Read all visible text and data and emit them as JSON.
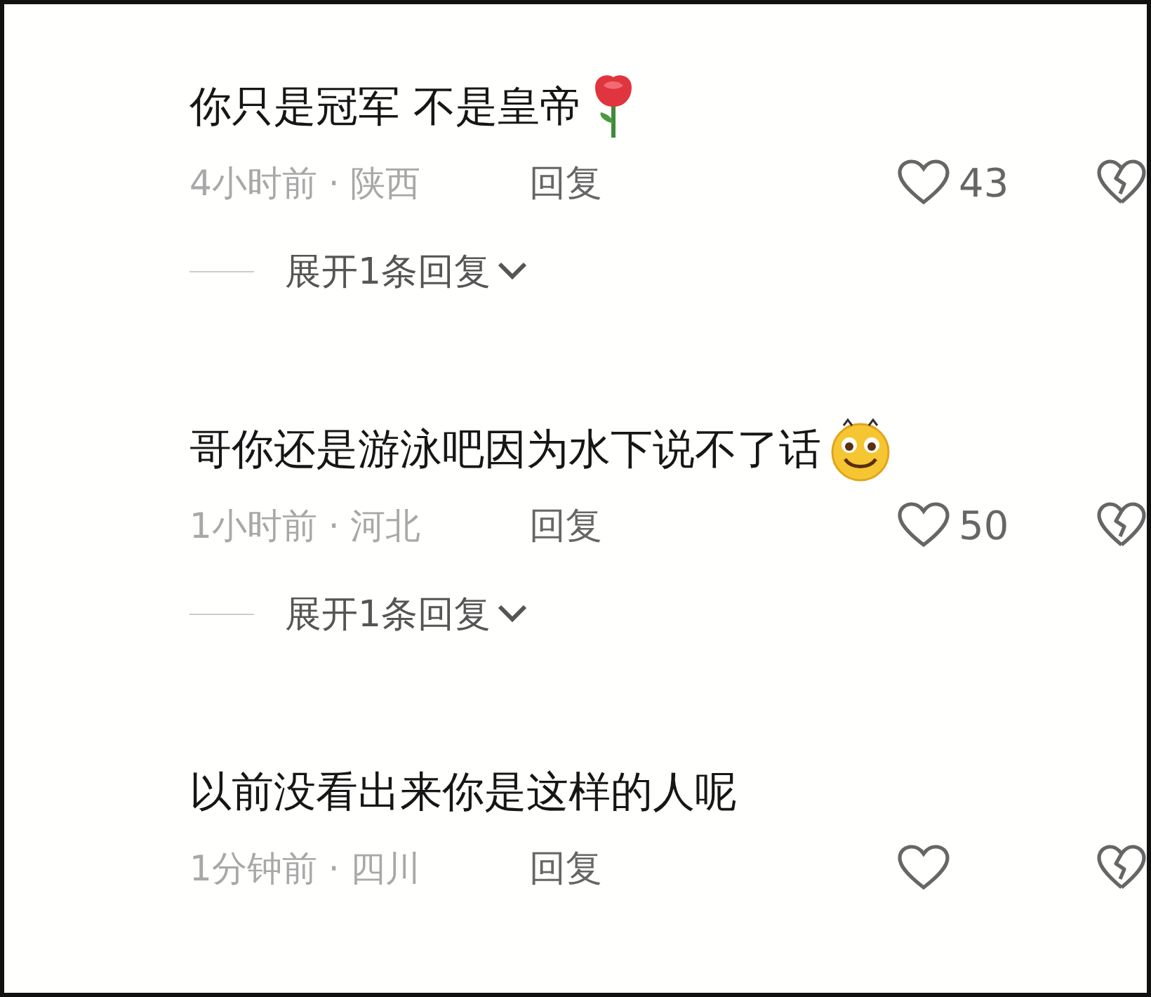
{
  "comments": [
    {
      "kind": "rose",
      "text": "你只是冠军 不是皇帝",
      "meta": "4小时前 · 陕西",
      "reply": "回复",
      "likes": "43",
      "expand": "展开1条回复"
    },
    {
      "kind": "smile",
      "text": "哥你还是游泳吧因为水下说不了话",
      "meta": "1小时前 · 河北",
      "reply": "回复",
      "likes": "50",
      "expand": "展开1条回复"
    },
    {
      "kind": "plain",
      "text": "以前没看出来你是这样的人呢",
      "meta": "1分钟前 · 四川",
      "reply": "回复"
    }
  ]
}
